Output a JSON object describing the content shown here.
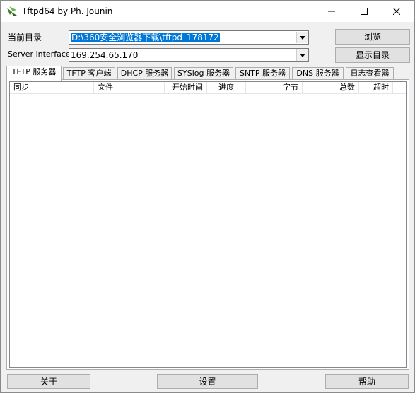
{
  "window": {
    "title": "Tftpd64 by Ph. Jounin",
    "icons": {
      "app": "tftpd-app-icon",
      "minimize": "minimize-icon",
      "maximize": "maximize-icon",
      "close": "close-icon"
    }
  },
  "form": {
    "dir_label": "当前目录",
    "dir_value": "D:\\360安全浏览器下载\\tftpd_178172",
    "browse_label": "浏览",
    "iface_label": "Server interface",
    "iface_value": "169.254.65.170",
    "show_dir_label": "显示目录"
  },
  "tabs": [
    {
      "label": "TFTP 服务器",
      "active": true
    },
    {
      "label": "TFTP 客户端",
      "active": false
    },
    {
      "label": "DHCP 服务器",
      "active": false
    },
    {
      "label": "SYSlog 服务器",
      "active": false
    },
    {
      "label": "SNTP 服务器",
      "active": false
    },
    {
      "label": "DNS 服务器",
      "active": false
    },
    {
      "label": "日志查看器",
      "active": false
    }
  ],
  "table": {
    "columns": [
      "同步",
      "文件",
      "开始时间",
      "进度",
      "字节",
      "总数",
      "超时"
    ],
    "rows": []
  },
  "footer": {
    "about_label": "关于",
    "settings_label": "设置",
    "help_label": "帮助"
  },
  "colors": {
    "selection": "#0078d7",
    "window_bg": "#f0f0f0",
    "button_bg": "#e1e1e1"
  }
}
